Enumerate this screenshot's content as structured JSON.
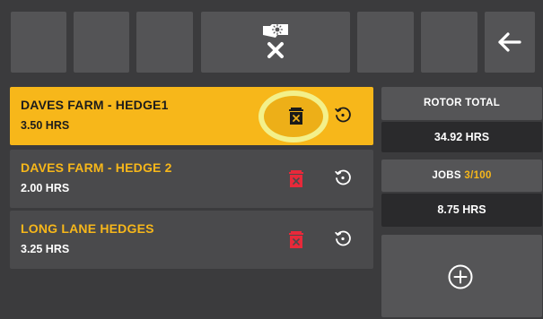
{
  "toolbar": {
    "center_icon": "clear-job-memory-icon",
    "back_icon": "arrow-left-icon"
  },
  "jobs": [
    {
      "name": "DAVES FARM - HEDGE1",
      "hours": "3.50 HRS",
      "selected": true
    },
    {
      "name": "DAVES FARM - HEDGE 2",
      "hours": "2.00 HRS",
      "selected": false
    },
    {
      "name": "LONG LANE HEDGES",
      "hours": "3.25 HRS",
      "selected": false
    }
  ],
  "rotor_total": {
    "label": "ROTOR TOTAL",
    "value": "34.92 HRS"
  },
  "jobs_summary": {
    "label": "JOBS",
    "count": "3/100",
    "value": "8.75 HRS"
  },
  "icons": {
    "delete": "trash-icon",
    "reset": "reset-timer-icon",
    "add": "plus-circle-icon"
  },
  "colors": {
    "accent": "#f7b71a",
    "delete_red": "#e8293a",
    "highlight_ring": "#f3f08a",
    "background": "#3b3b3d"
  }
}
